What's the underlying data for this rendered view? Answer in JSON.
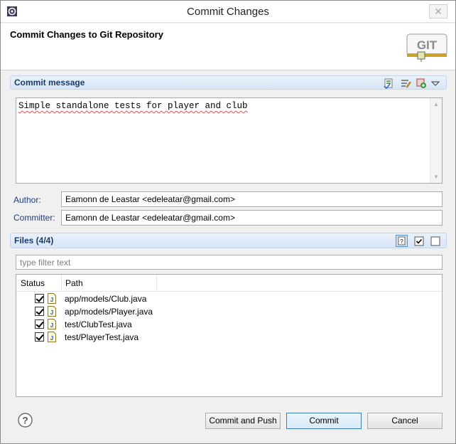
{
  "window": {
    "title": "Commit Changes"
  },
  "header": {
    "heading": "Commit Changes to Git Repository",
    "logo_text": "GIT"
  },
  "commit_message": {
    "section_title": "Commit message",
    "text": "Simple standalone tests for player and club"
  },
  "author": {
    "label": "Author:",
    "value": "Eamonn de Leastar <edeleatar@gmail.com>"
  },
  "committer": {
    "label": "Committer:",
    "value": "Eamonn de Leastar <edeleatar@gmail.com>"
  },
  "files": {
    "section_title": "Files (4/4)",
    "filter_placeholder": "type filter text",
    "columns": {
      "status": "Status",
      "path": "Path"
    },
    "rows": [
      {
        "path": "app/models/Club.java"
      },
      {
        "path": "app/models/Player.java"
      },
      {
        "path": "test/ClubTest.java"
      },
      {
        "path": "test/PlayerTest.java"
      }
    ]
  },
  "buttons": {
    "commit_and_push": "Commit and Push",
    "commit": "Commit",
    "cancel": "Cancel"
  },
  "colors": {
    "accent": "#1a3b6e",
    "section_bg": "#d7e5f6",
    "default_button_border": "#3c7fb1"
  }
}
